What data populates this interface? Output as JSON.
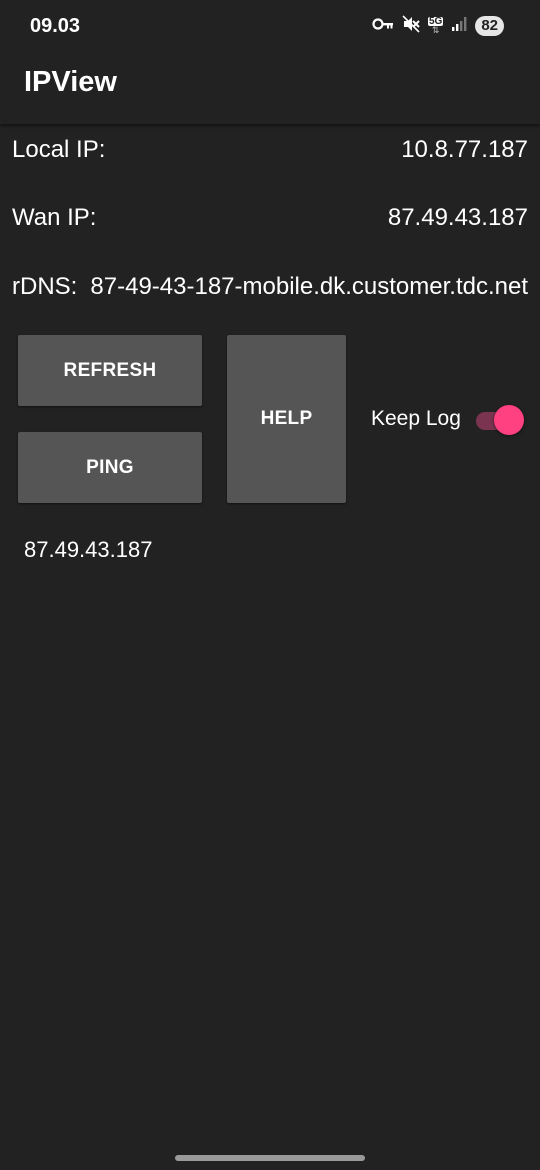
{
  "status_bar": {
    "time": "09.03",
    "network": "5G",
    "battery": "82",
    "icons": [
      "key-icon",
      "mute-icon",
      "5g-icon",
      "signal-icon",
      "battery-icon"
    ]
  },
  "app": {
    "title": "IPView"
  },
  "info": {
    "local_ip_label": "Local IP:",
    "local_ip_value": "10.8.77.187",
    "wan_ip_label": "Wan IP:",
    "wan_ip_value": "87.49.43.187",
    "rdns_label": "rDNS:",
    "rdns_value": "87-49-43-187-mobile.dk.customer.tdc.net"
  },
  "buttons": {
    "refresh": "REFRESH",
    "ping": "PING",
    "help": "HELP"
  },
  "keep_log": {
    "label": "Keep Log",
    "enabled": true
  },
  "log": {
    "text": "87.49.43.187"
  },
  "colors": {
    "background": "#222222",
    "button": "#555555",
    "accent": "#ff4081",
    "switch_track": "#7a3450"
  }
}
